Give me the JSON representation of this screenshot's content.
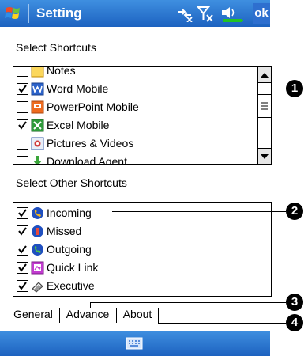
{
  "titlebar": {
    "title": "Setting",
    "ok_label": "ok"
  },
  "shortcuts": {
    "section_label": "Select Shortcuts",
    "items": [
      {
        "label": "Notes",
        "checked": false,
        "icon": "notes-icon"
      },
      {
        "label": "Word Mobile",
        "checked": true,
        "icon": "word-mobile-icon"
      },
      {
        "label": "PowerPoint Mobile",
        "checked": false,
        "icon": "powerpoint-mobile-icon"
      },
      {
        "label": "Excel Mobile",
        "checked": true,
        "icon": "excel-mobile-icon"
      },
      {
        "label": "Pictures & Videos",
        "checked": false,
        "icon": "pictures-videos-icon"
      },
      {
        "label": "Download Agent",
        "checked": false,
        "icon": "download-agent-icon"
      }
    ]
  },
  "other_shortcuts": {
    "section_label": "Select Other Shortcuts",
    "items": [
      {
        "label": "Incoming",
        "checked": true,
        "icon": "incoming-call-icon"
      },
      {
        "label": "Missed",
        "checked": true,
        "icon": "missed-call-icon"
      },
      {
        "label": "Outgoing",
        "checked": true,
        "icon": "outgoing-call-icon"
      },
      {
        "label": "Quick Link",
        "checked": true,
        "icon": "quick-link-icon"
      },
      {
        "label": "Executive",
        "checked": true,
        "icon": "executive-icon"
      }
    ]
  },
  "callouts": [
    "1",
    "2",
    "3",
    "4"
  ],
  "tabs": [
    {
      "label": "General",
      "active": true
    },
    {
      "label": "Advance",
      "active": false
    },
    {
      "label": "About",
      "active": false
    }
  ],
  "colors": {
    "titlebar": "#1d62c0",
    "accent": "#2e6fcf",
    "battery": "#22c322"
  }
}
